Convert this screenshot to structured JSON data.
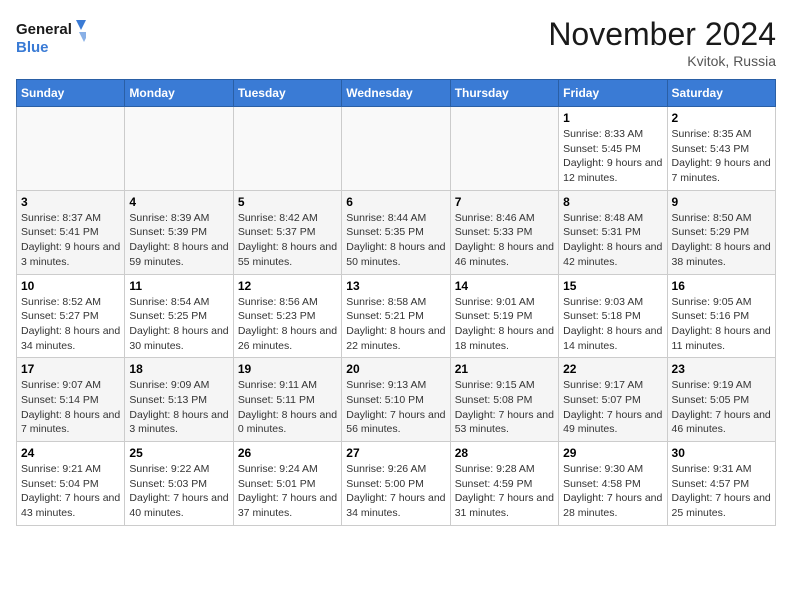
{
  "header": {
    "logo_line1": "General",
    "logo_line2": "Blue",
    "month": "November 2024",
    "location": "Kvitok, Russia"
  },
  "weekdays": [
    "Sunday",
    "Monday",
    "Tuesday",
    "Wednesday",
    "Thursday",
    "Friday",
    "Saturday"
  ],
  "weeks": [
    [
      {
        "day": "",
        "info": ""
      },
      {
        "day": "",
        "info": ""
      },
      {
        "day": "",
        "info": ""
      },
      {
        "day": "",
        "info": ""
      },
      {
        "day": "",
        "info": ""
      },
      {
        "day": "1",
        "info": "Sunrise: 8:33 AM\nSunset: 5:45 PM\nDaylight: 9 hours and 12 minutes."
      },
      {
        "day": "2",
        "info": "Sunrise: 8:35 AM\nSunset: 5:43 PM\nDaylight: 9 hours and 7 minutes."
      }
    ],
    [
      {
        "day": "3",
        "info": "Sunrise: 8:37 AM\nSunset: 5:41 PM\nDaylight: 9 hours and 3 minutes."
      },
      {
        "day": "4",
        "info": "Sunrise: 8:39 AM\nSunset: 5:39 PM\nDaylight: 8 hours and 59 minutes."
      },
      {
        "day": "5",
        "info": "Sunrise: 8:42 AM\nSunset: 5:37 PM\nDaylight: 8 hours and 55 minutes."
      },
      {
        "day": "6",
        "info": "Sunrise: 8:44 AM\nSunset: 5:35 PM\nDaylight: 8 hours and 50 minutes."
      },
      {
        "day": "7",
        "info": "Sunrise: 8:46 AM\nSunset: 5:33 PM\nDaylight: 8 hours and 46 minutes."
      },
      {
        "day": "8",
        "info": "Sunrise: 8:48 AM\nSunset: 5:31 PM\nDaylight: 8 hours and 42 minutes."
      },
      {
        "day": "9",
        "info": "Sunrise: 8:50 AM\nSunset: 5:29 PM\nDaylight: 8 hours and 38 minutes."
      }
    ],
    [
      {
        "day": "10",
        "info": "Sunrise: 8:52 AM\nSunset: 5:27 PM\nDaylight: 8 hours and 34 minutes."
      },
      {
        "day": "11",
        "info": "Sunrise: 8:54 AM\nSunset: 5:25 PM\nDaylight: 8 hours and 30 minutes."
      },
      {
        "day": "12",
        "info": "Sunrise: 8:56 AM\nSunset: 5:23 PM\nDaylight: 8 hours and 26 minutes."
      },
      {
        "day": "13",
        "info": "Sunrise: 8:58 AM\nSunset: 5:21 PM\nDaylight: 8 hours and 22 minutes."
      },
      {
        "day": "14",
        "info": "Sunrise: 9:01 AM\nSunset: 5:19 PM\nDaylight: 8 hours and 18 minutes."
      },
      {
        "day": "15",
        "info": "Sunrise: 9:03 AM\nSunset: 5:18 PM\nDaylight: 8 hours and 14 minutes."
      },
      {
        "day": "16",
        "info": "Sunrise: 9:05 AM\nSunset: 5:16 PM\nDaylight: 8 hours and 11 minutes."
      }
    ],
    [
      {
        "day": "17",
        "info": "Sunrise: 9:07 AM\nSunset: 5:14 PM\nDaylight: 8 hours and 7 minutes."
      },
      {
        "day": "18",
        "info": "Sunrise: 9:09 AM\nSunset: 5:13 PM\nDaylight: 8 hours and 3 minutes."
      },
      {
        "day": "19",
        "info": "Sunrise: 9:11 AM\nSunset: 5:11 PM\nDaylight: 8 hours and 0 minutes."
      },
      {
        "day": "20",
        "info": "Sunrise: 9:13 AM\nSunset: 5:10 PM\nDaylight: 7 hours and 56 minutes."
      },
      {
        "day": "21",
        "info": "Sunrise: 9:15 AM\nSunset: 5:08 PM\nDaylight: 7 hours and 53 minutes."
      },
      {
        "day": "22",
        "info": "Sunrise: 9:17 AM\nSunset: 5:07 PM\nDaylight: 7 hours and 49 minutes."
      },
      {
        "day": "23",
        "info": "Sunrise: 9:19 AM\nSunset: 5:05 PM\nDaylight: 7 hours and 46 minutes."
      }
    ],
    [
      {
        "day": "24",
        "info": "Sunrise: 9:21 AM\nSunset: 5:04 PM\nDaylight: 7 hours and 43 minutes."
      },
      {
        "day": "25",
        "info": "Sunrise: 9:22 AM\nSunset: 5:03 PM\nDaylight: 7 hours and 40 minutes."
      },
      {
        "day": "26",
        "info": "Sunrise: 9:24 AM\nSunset: 5:01 PM\nDaylight: 7 hours and 37 minutes."
      },
      {
        "day": "27",
        "info": "Sunrise: 9:26 AM\nSunset: 5:00 PM\nDaylight: 7 hours and 34 minutes."
      },
      {
        "day": "28",
        "info": "Sunrise: 9:28 AM\nSunset: 4:59 PM\nDaylight: 7 hours and 31 minutes."
      },
      {
        "day": "29",
        "info": "Sunrise: 9:30 AM\nSunset: 4:58 PM\nDaylight: 7 hours and 28 minutes."
      },
      {
        "day": "30",
        "info": "Sunrise: 9:31 AM\nSunset: 4:57 PM\nDaylight: 7 hours and 25 minutes."
      }
    ]
  ]
}
